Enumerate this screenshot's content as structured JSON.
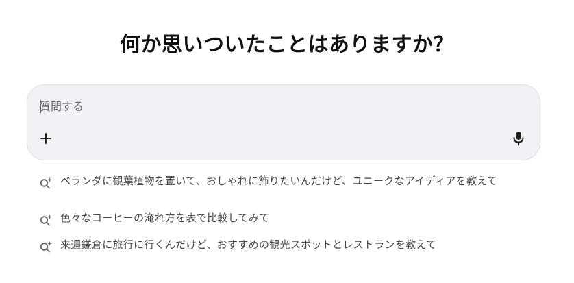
{
  "headline": "何か思いついたことはありますか？",
  "composer": {
    "placeholder": "質問する",
    "add_icon": "plus-icon",
    "mic_icon": "microphone-icon"
  },
  "suggestions": [
    {
      "icon": "search-sparkle-icon",
      "text": "ベランダに観葉植物を置いて、おしゃれに飾りたいんだけど、ユニークなアイディアを教えて"
    },
    {
      "icon": "search-sparkle-icon",
      "text": "色々なコーヒーの淹れ方を表で比較してみて"
    },
    {
      "icon": "search-sparkle-icon",
      "text": "来週鎌倉に旅行に行くんだけど、おすすめの観光スポットとレストランを教えて"
    }
  ],
  "colors": {
    "composer_bg": "#f0f2f5",
    "caret": "#1a73e8",
    "suggestion_text": "#444746"
  }
}
